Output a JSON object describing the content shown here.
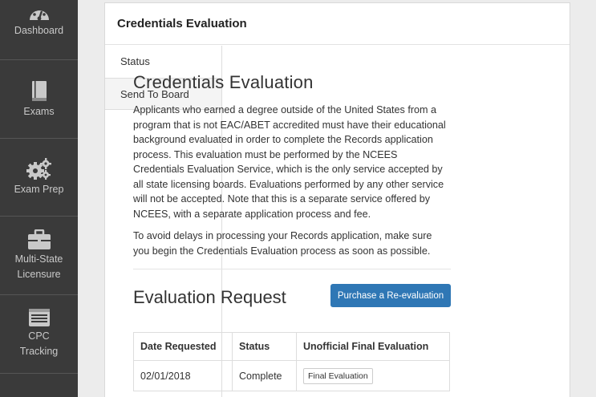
{
  "sidebar": {
    "items": [
      {
        "label": "Dashboard",
        "icon": "gauge-icon"
      },
      {
        "label": "Exams",
        "icon": "book-icon"
      },
      {
        "label": "Exam Prep",
        "icon": "gears-icon"
      },
      {
        "label": "Multi-State Licensure",
        "icon": "briefcase-icon"
      },
      {
        "label": "CPC Tracking",
        "icon": "list-icon"
      }
    ]
  },
  "panel": {
    "title": "Credentials Evaluation",
    "tabs": [
      {
        "label": "Status"
      },
      {
        "label": "Send To Board"
      }
    ]
  },
  "content": {
    "heading": "Credentials Evaluation",
    "paragraph1": "Applicants who earned a degree outside of the United States from a program that is not EAC/ABET accredited must have their educational background evaluated in order to complete the Records application process. This evaluation must be performed by the NCEES Credentials Evaluation Service, which is the only service accepted by all state licensing boards. Evaluations performed by any other service will not be accepted. Note that this is a separate service offered by NCEES, with a separate application process and fee.",
    "paragraph2": "To avoid delays in processing your Records application, make sure you begin the Credentials Evaluation process as soon as possible.",
    "request_heading": "Evaluation Request",
    "reevaluate_button": "Purchase a Re-evaluation"
  },
  "table": {
    "headers": [
      "Date Requested",
      "Status",
      "Unofficial Final Evaluation"
    ],
    "rows": [
      {
        "date": "02/01/2018",
        "status": "Complete",
        "action": "Final Evaluation"
      }
    ]
  },
  "colors": {
    "sidebar_bg": "#3a3a3a",
    "accent": "#2f77b5"
  }
}
